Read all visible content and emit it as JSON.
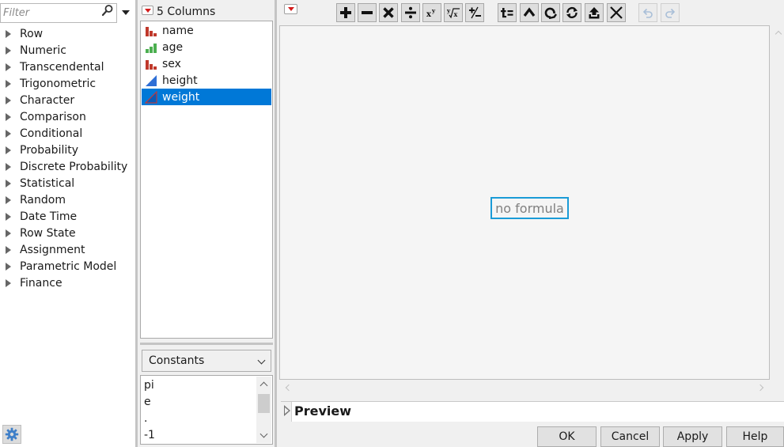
{
  "function_panel": {
    "filter_placeholder": "Filter",
    "categories": [
      {
        "label": "Row"
      },
      {
        "label": "Numeric"
      },
      {
        "label": "Transcendental"
      },
      {
        "label": "Trigonometric"
      },
      {
        "label": "Character"
      },
      {
        "label": "Comparison"
      },
      {
        "label": "Conditional"
      },
      {
        "label": "Probability"
      },
      {
        "label": "Discrete Probability"
      },
      {
        "label": "Statistical"
      },
      {
        "label": "Random"
      },
      {
        "label": "Date Time"
      },
      {
        "label": "Row State"
      },
      {
        "label": "Assignment"
      },
      {
        "label": "Parametric Model"
      },
      {
        "label": "Finance"
      }
    ]
  },
  "column_panel": {
    "header": "5 Columns",
    "columns": [
      {
        "name": "name",
        "icon": "nominal-bar-icon",
        "selected": false
      },
      {
        "name": "age",
        "icon": "ordinal-bar-icon",
        "selected": false
      },
      {
        "name": "sex",
        "icon": "nominal-bar-icon",
        "selected": false
      },
      {
        "name": "height",
        "icon": "continuous-triangle-icon",
        "selected": false
      },
      {
        "name": "weight",
        "icon": "continuous-triangle-icon",
        "selected": true
      }
    ],
    "constants_select": {
      "value": "Constants"
    },
    "constants": [
      {
        "label": "pi"
      },
      {
        "label": "e"
      },
      {
        "label": "."
      },
      {
        "label": "-1"
      }
    ]
  },
  "formula_editor": {
    "toolbar": [
      {
        "name": "add-button",
        "icon": "plus-icon",
        "enabled": true
      },
      {
        "name": "subtract-button",
        "icon": "minus-icon",
        "enabled": true
      },
      {
        "name": "multiply-button",
        "icon": "times-icon",
        "enabled": true
      },
      {
        "name": "divide-button",
        "icon": "divide-icon",
        "enabled": true
      },
      {
        "name": "power-button",
        "icon": "power-icon",
        "enabled": true
      },
      {
        "name": "root-button",
        "icon": "root-icon",
        "enabled": true
      },
      {
        "name": "change-sign-button",
        "icon": "plus-minus-icon",
        "enabled": true
      },
      {
        "name": "local-variable-button",
        "icon": "assign-icon",
        "enabled": true
      },
      {
        "name": "peel-button",
        "icon": "caret-up-icon",
        "enabled": true
      },
      {
        "name": "unary-button",
        "icon": "unary-icon",
        "enabled": true
      },
      {
        "name": "swap-button",
        "icon": "swap-icon",
        "enabled": true
      },
      {
        "name": "upload-button",
        "icon": "upload-icon",
        "enabled": true
      },
      {
        "name": "delete-button",
        "icon": "delete-icon",
        "enabled": true
      },
      {
        "name": "undo-button",
        "icon": "undo-icon",
        "enabled": false
      },
      {
        "name": "redo-button",
        "icon": "redo-icon",
        "enabled": false
      }
    ],
    "placeholder": "no formula",
    "preview_label": "Preview",
    "accent_color": "#1a9bd7"
  },
  "dialog_buttons": {
    "ok": "OK",
    "cancel": "Cancel",
    "apply": "Apply",
    "help": "Help"
  },
  "colors": {
    "selection": "#0078d7",
    "nominal": "#c0392b",
    "ordinal": "#4caf50",
    "continuous": "#2e6fd6"
  }
}
